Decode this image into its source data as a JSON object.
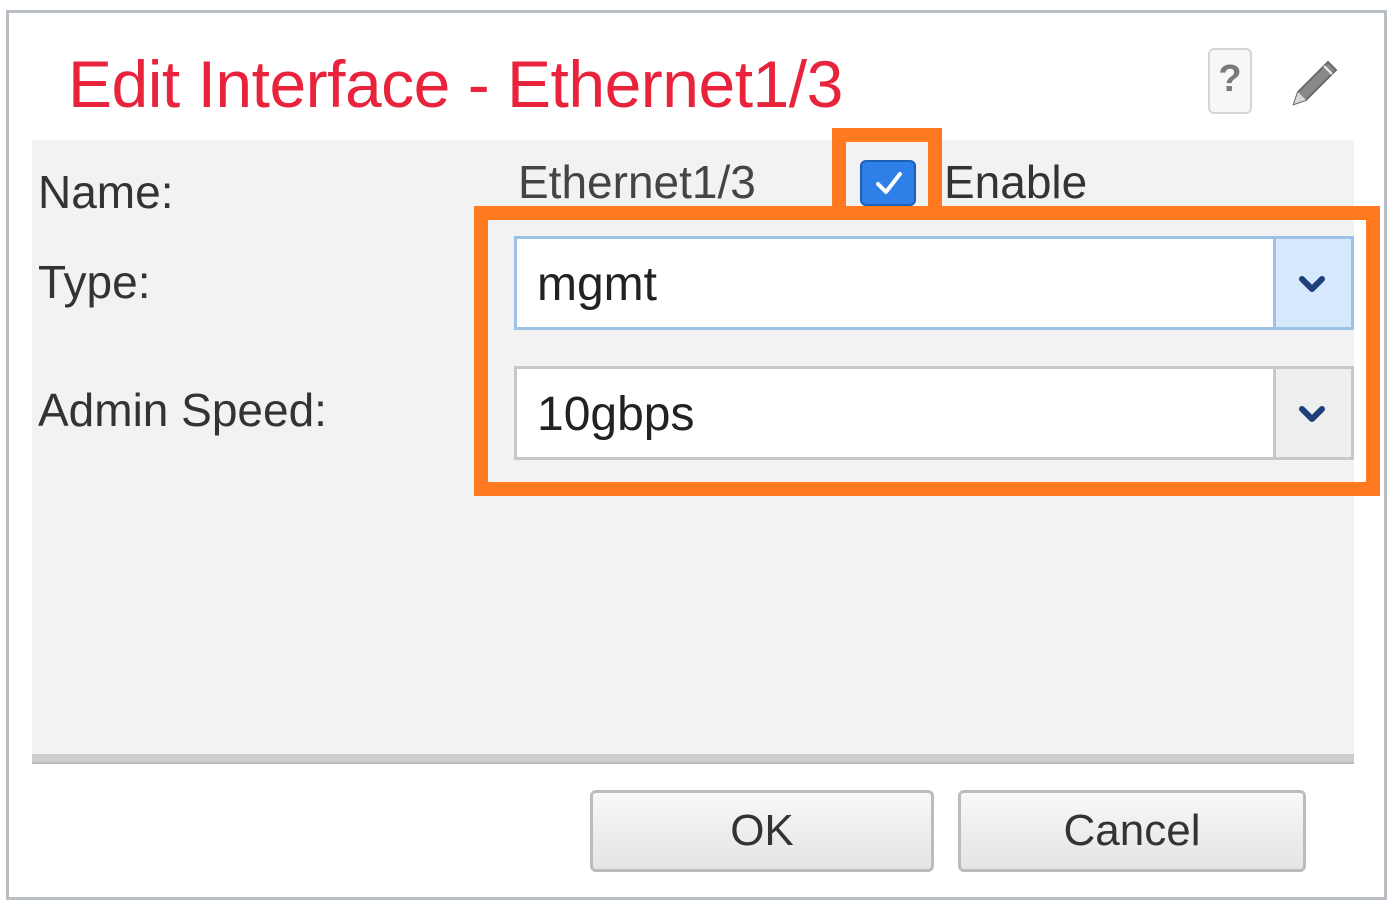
{
  "dialog": {
    "title": "Edit Interface - Ethernet1/3",
    "help_label": "?",
    "title_color": "#e8233b",
    "accent_color": "#2f7fe8",
    "highlight_color": "#ff7a1e"
  },
  "form": {
    "name_label": "Name:",
    "name_value": "Ethernet1/3",
    "enable_label": "Enable",
    "enable_checked": true,
    "type_label": "Type:",
    "type_value": "mgmt",
    "speed_label": "Admin Speed:",
    "speed_value": "10gbps"
  },
  "buttons": {
    "ok_label": "OK",
    "cancel_label": "Cancel"
  },
  "icons": {
    "help": "help-icon",
    "edit": "pencil-icon",
    "dropdown": "chevron-down-icon",
    "check": "check-icon"
  }
}
